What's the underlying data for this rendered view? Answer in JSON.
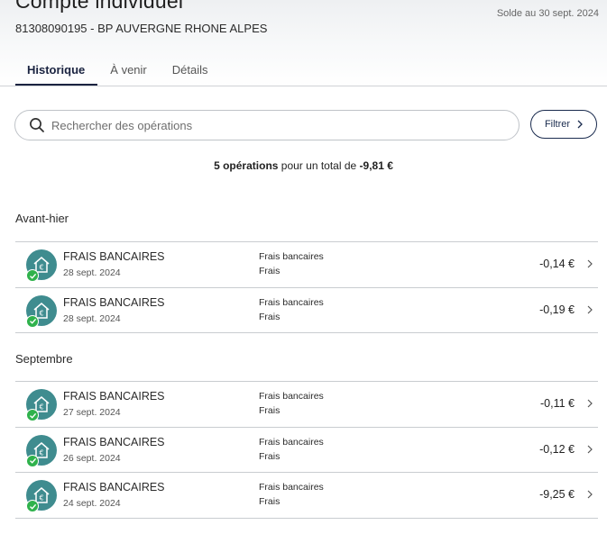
{
  "header": {
    "account_title": "Compte individuel",
    "account_subtitle": "81308090195 - BP AUVERGNE RHONE ALPES",
    "solde_label": "Solde au 30 sept. 2024"
  },
  "tabs": [
    {
      "label": "Historique",
      "active": true
    },
    {
      "label": "À venir",
      "active": false
    },
    {
      "label": "Détails",
      "active": false
    }
  ],
  "search": {
    "placeholder": "Rechercher des opérations",
    "icon": "search-icon"
  },
  "filter": {
    "label": "Filtrer",
    "icon": "chevron-right-icon"
  },
  "summary": {
    "count_text": "5 opérations",
    "middle_text": " pour un total de ",
    "total": "-9,81 €"
  },
  "colors": {
    "accent": "#1a2b4e",
    "icon_bg": "#3f8c8f",
    "status_ok": "#2fb24c"
  },
  "groups": [
    {
      "title": "Avant-hier",
      "items": [
        {
          "name": "FRAIS BANCAIRES",
          "date": "28 sept. 2024",
          "category": "Frais bancaires",
          "subcategory": "Frais",
          "amount": "-0,14 €"
        },
        {
          "name": "FRAIS BANCAIRES",
          "date": "28 sept. 2024",
          "category": "Frais bancaires",
          "subcategory": "Frais",
          "amount": "-0,19 €"
        }
      ]
    },
    {
      "title": "Septembre",
      "items": [
        {
          "name": "FRAIS BANCAIRES",
          "date": "27 sept. 2024",
          "category": "Frais bancaires",
          "subcategory": "Frais",
          "amount": "-0,11 €"
        },
        {
          "name": "FRAIS BANCAIRES",
          "date": "26 sept. 2024",
          "category": "Frais bancaires",
          "subcategory": "Frais",
          "amount": "-0,12 €"
        },
        {
          "name": "FRAIS BANCAIRES",
          "date": "24 sept. 2024",
          "category": "Frais bancaires",
          "subcategory": "Frais",
          "amount": "-9,25 €"
        }
      ]
    }
  ]
}
